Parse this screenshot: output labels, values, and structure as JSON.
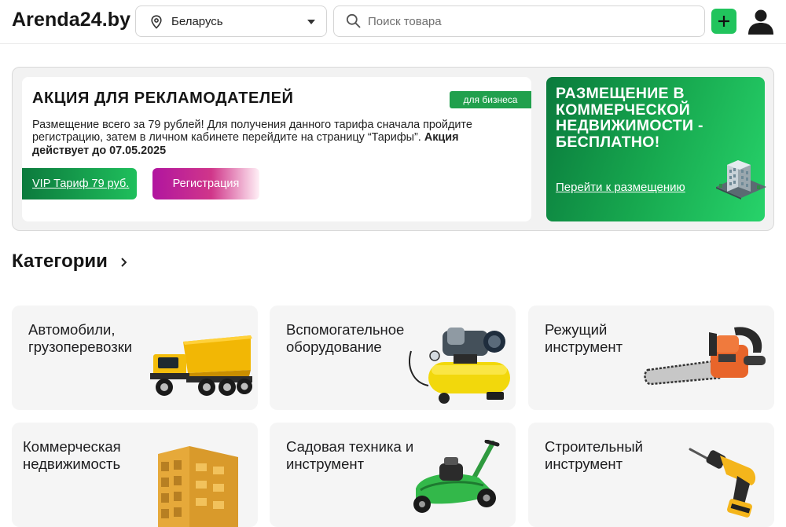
{
  "header": {
    "logo": "Arenda24.by",
    "region": "Беларусь",
    "search_placeholder": "Поиск товара"
  },
  "promo": {
    "title": "АКЦИЯ ДЛЯ РЕКЛАМОДАТЕЛЕЙ",
    "badge": "для бизнеса",
    "text_main": "Размещение всего за 79 рублей! Для получения данного тарифа сначала пройдите регистрацию, затем в личном кабинете перейдите на страницу “Тарифы”. ",
    "text_bold": "Акция действует до 07.05.2025",
    "vip_button": "VIP Тариф 79 руб.",
    "register_button": "Регистрация"
  },
  "commercial_promo": {
    "title": "РАЗМЕЩЕНИЕ В КОММЕРЧЕСКОЙ НЕДВИЖИМОСТИ - БЕСПЛАТНО!",
    "link": "Перейти к размещению"
  },
  "categories": {
    "heading": "Категории",
    "items": [
      {
        "label": "Автомобили, грузоперевозки",
        "icon": "dump-truck-icon"
      },
      {
        "label": "Вспомогательное оборудование",
        "icon": "air-compressor-icon"
      },
      {
        "label": "Режущий инструмент",
        "icon": "chainsaw-icon"
      },
      {
        "label": "Коммерческая недвижимость",
        "icon": "building-icon"
      },
      {
        "label": "Садовая техника и инструмент",
        "icon": "lawn-mower-icon"
      },
      {
        "label": "Строительный инструмент",
        "icon": "drill-icon"
      }
    ]
  },
  "colors": {
    "accent_green": "#21c45d",
    "dark_green": "#0a7a3c",
    "magenta": "#b1159f"
  }
}
